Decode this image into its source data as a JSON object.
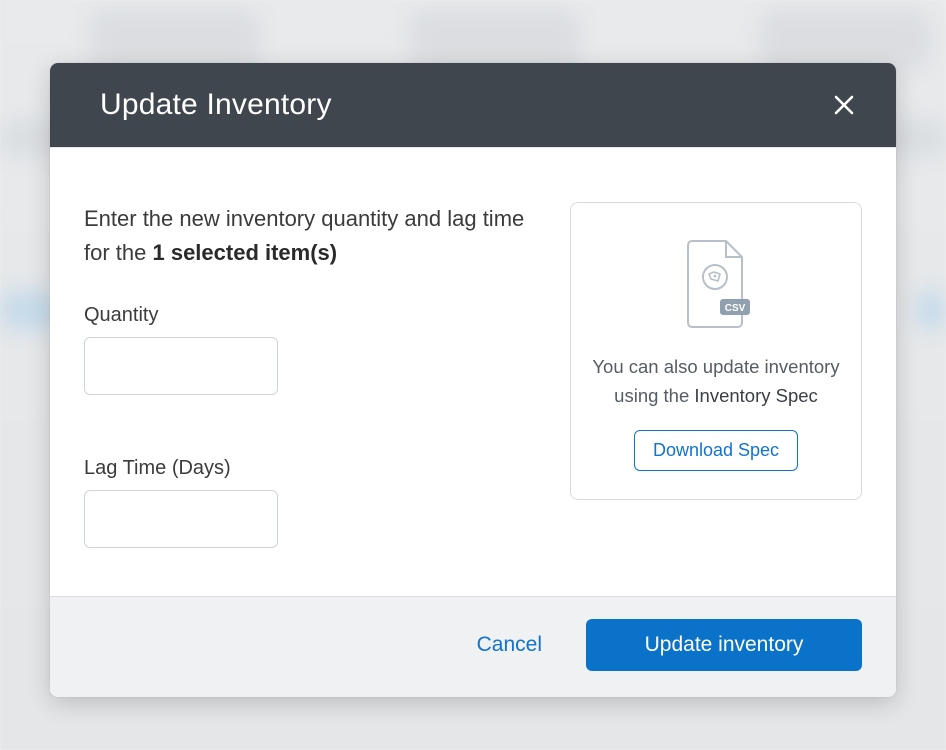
{
  "modal": {
    "title": "Update Inventory",
    "close_icon": "close-icon",
    "intro_prefix": "Enter the new inventory quantity and lag time for the ",
    "intro_bold": "1 selected item(s)",
    "quantity_label": "Quantity",
    "quantity_value": "",
    "lagtime_label": "Lag Time (Days)",
    "lagtime_value": "",
    "spec": {
      "text_prefix": "You can also update inventory using the ",
      "text_emph": "Inventory Spec",
      "download_label": "Download Spec",
      "csv_badge": "CSV"
    },
    "footer": {
      "cancel_label": "Cancel",
      "submit_label": "Update inventory"
    }
  },
  "colors": {
    "primary": "#0a73c9",
    "header_bg": "#3f464d"
  }
}
